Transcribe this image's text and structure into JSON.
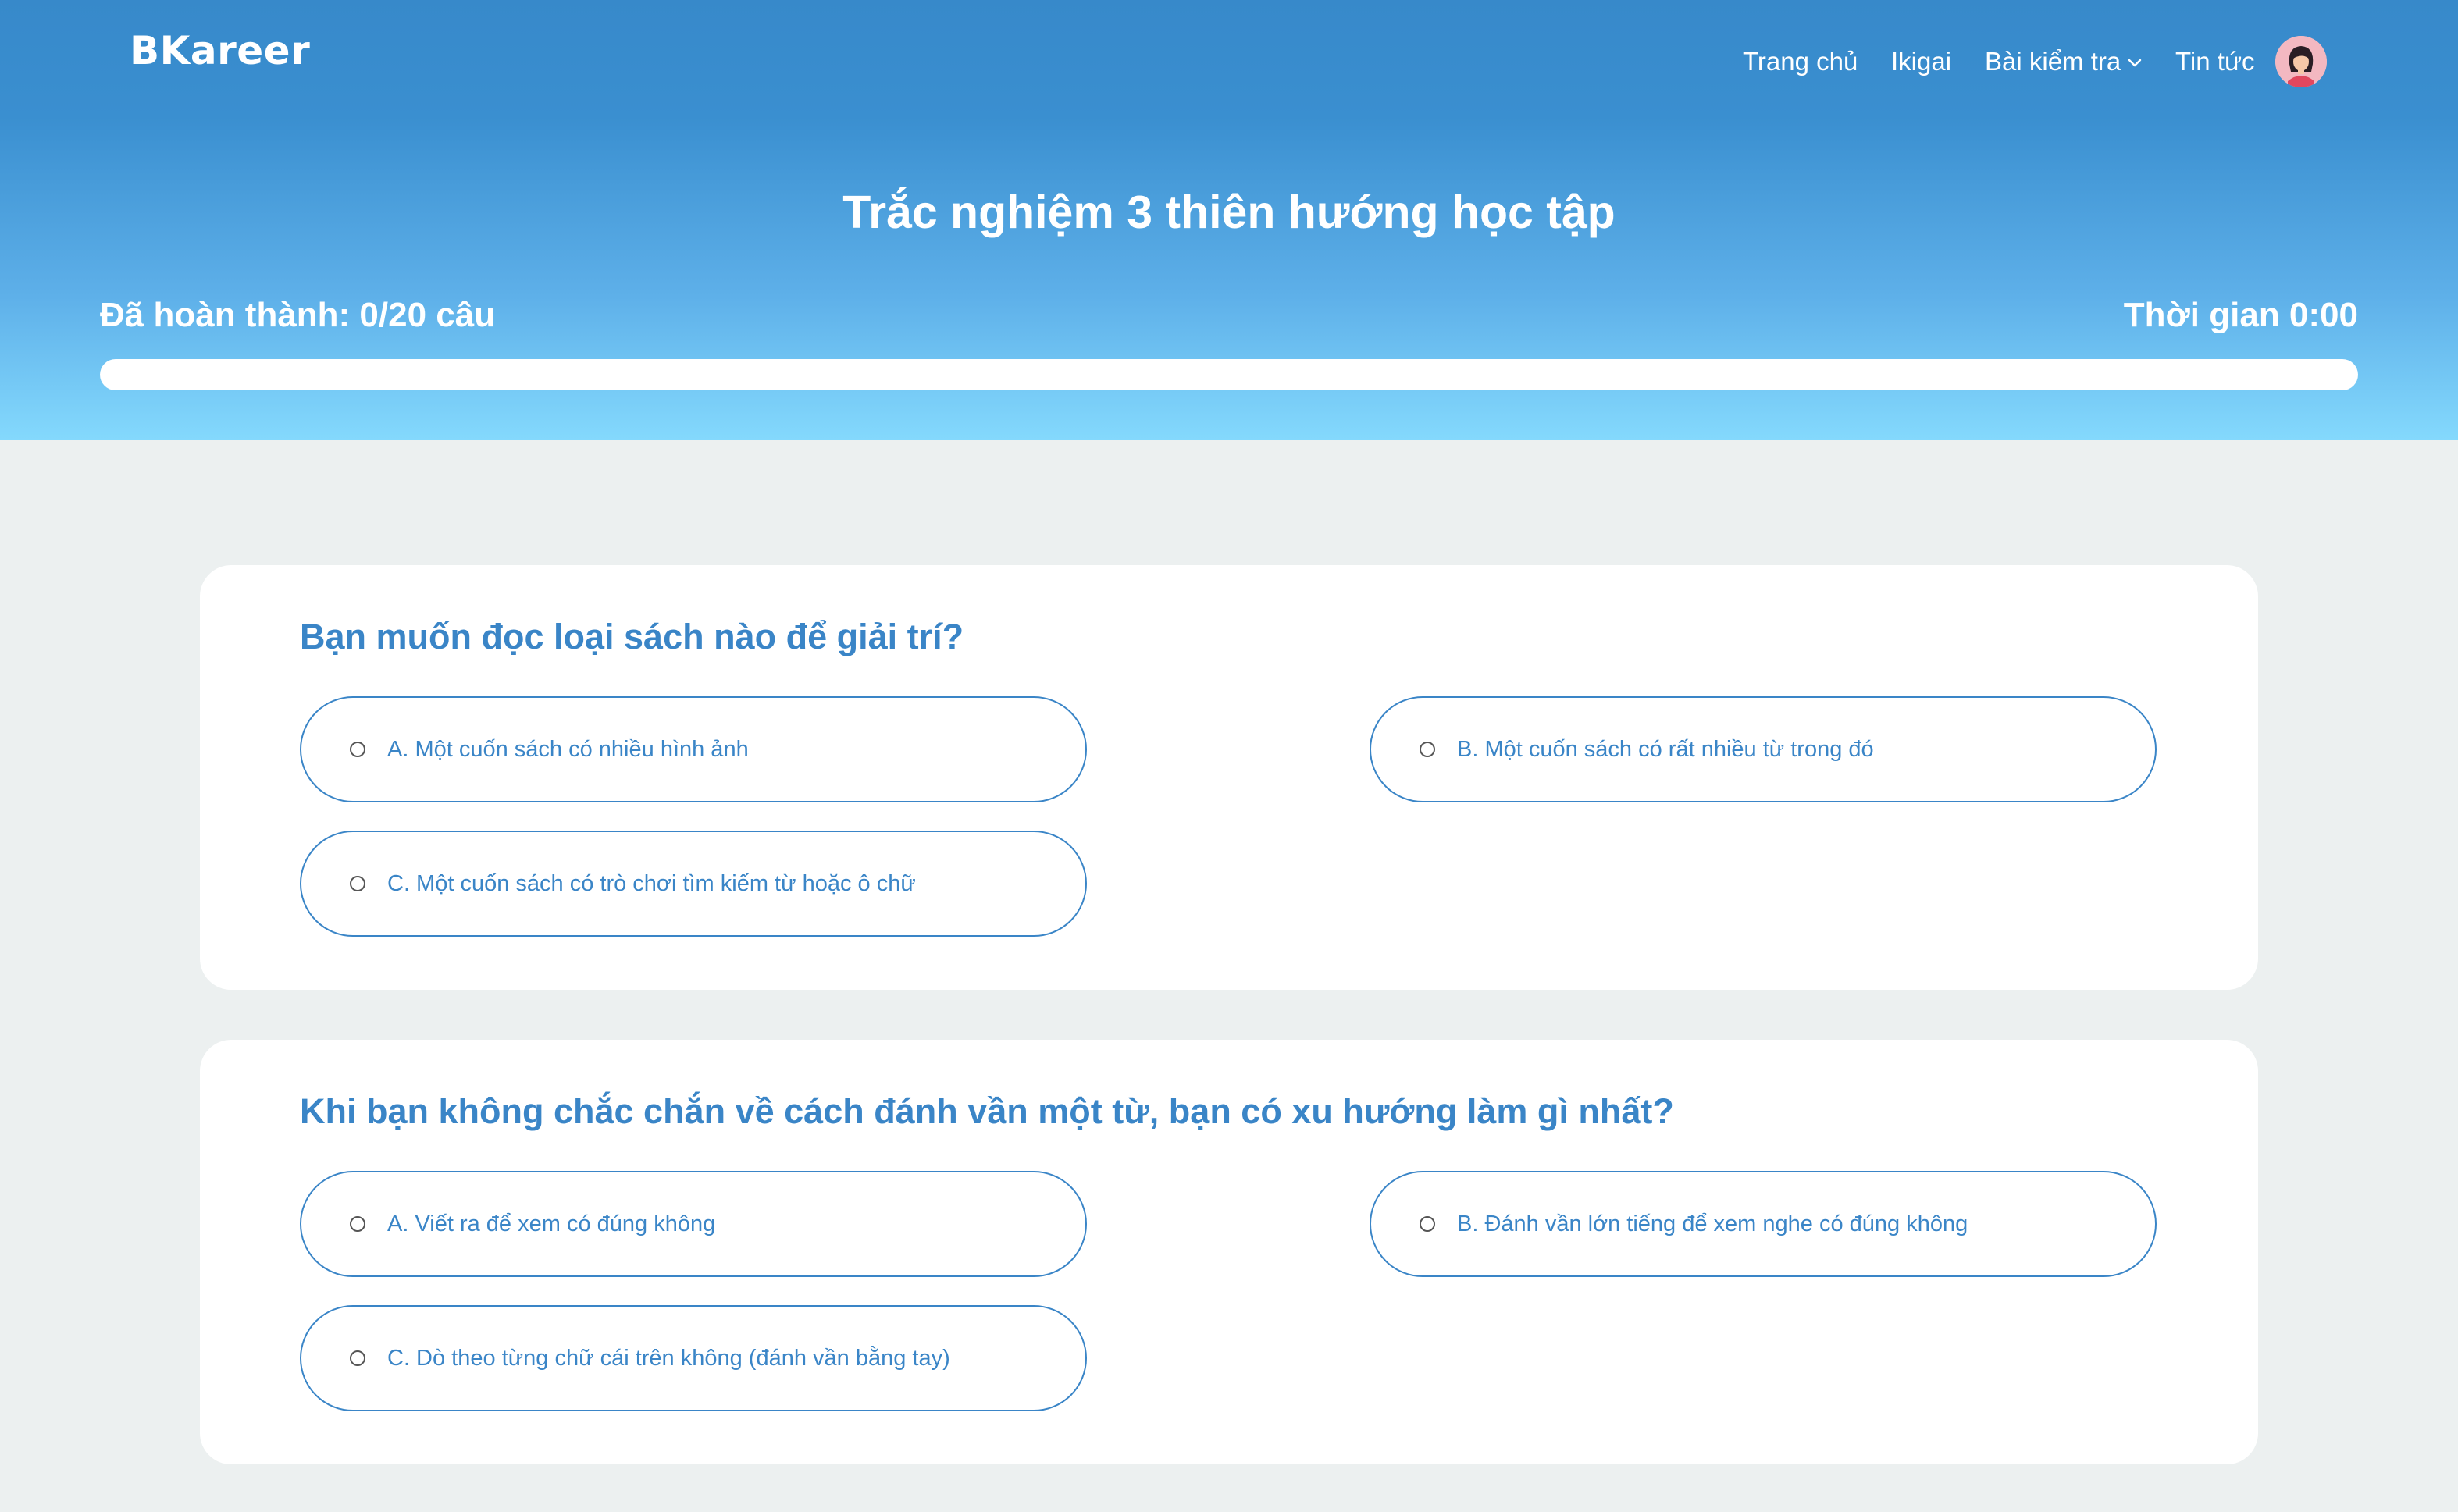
{
  "app": {
    "logo": "BKareer"
  },
  "nav": {
    "home": "Trang chủ",
    "ikigai": "Ikigai",
    "tests": "Bài kiểm tra",
    "news": "Tin tức"
  },
  "quiz": {
    "title": "Trắc nghiệm 3 thiên hướng học tập",
    "progress_label": "Đã hoàn thành: 0/20 câu",
    "progress_fraction": 0,
    "timer_label": "Thời gian 0:00"
  },
  "questions": [
    {
      "text": "Bạn muốn đọc loại sách nào để giải trí?",
      "options": [
        "A. Một cuốn sách có nhiều hình ảnh",
        "B. Một cuốn sách có rất nhiều từ trong đó",
        "C. Một cuốn sách có trò chơi tìm kiếm từ hoặc ô chữ"
      ]
    },
    {
      "text": "Khi bạn không chắc chắn về cách đánh vần một từ, bạn có xu hướng làm gì nhất?",
      "options": [
        "A. Viết ra để xem có đúng không",
        "B. Đánh vần lớn tiếng để xem nghe có đúng không",
        "C. Dò theo từng chữ cái trên không (đánh vần bằng tay)"
      ]
    }
  ],
  "icons": {
    "nav_dropdown": "chevron-down-icon",
    "avatar": "user-avatar-icon",
    "option_radio": "radio-unchecked-icon"
  },
  "colors": {
    "header_top": "#3789ca",
    "header_bottom": "#84d9fd",
    "accent": "#3a85c7",
    "page_background": "#ecf0f0",
    "card_background": "#ffffff"
  }
}
